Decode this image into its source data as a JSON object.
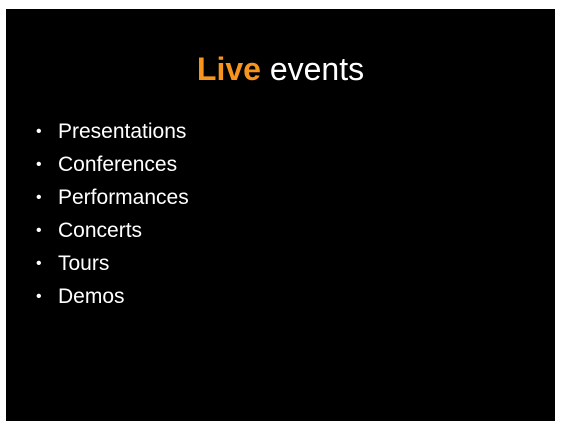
{
  "slide": {
    "title_accent": "Live",
    "title_rest": " events",
    "accent_color": "#f7941d",
    "bullet_symbol": "•",
    "items": [
      "Presentations",
      "Conferences",
      "Performances",
      "Concerts",
      "Tours",
      "Demos"
    ]
  }
}
